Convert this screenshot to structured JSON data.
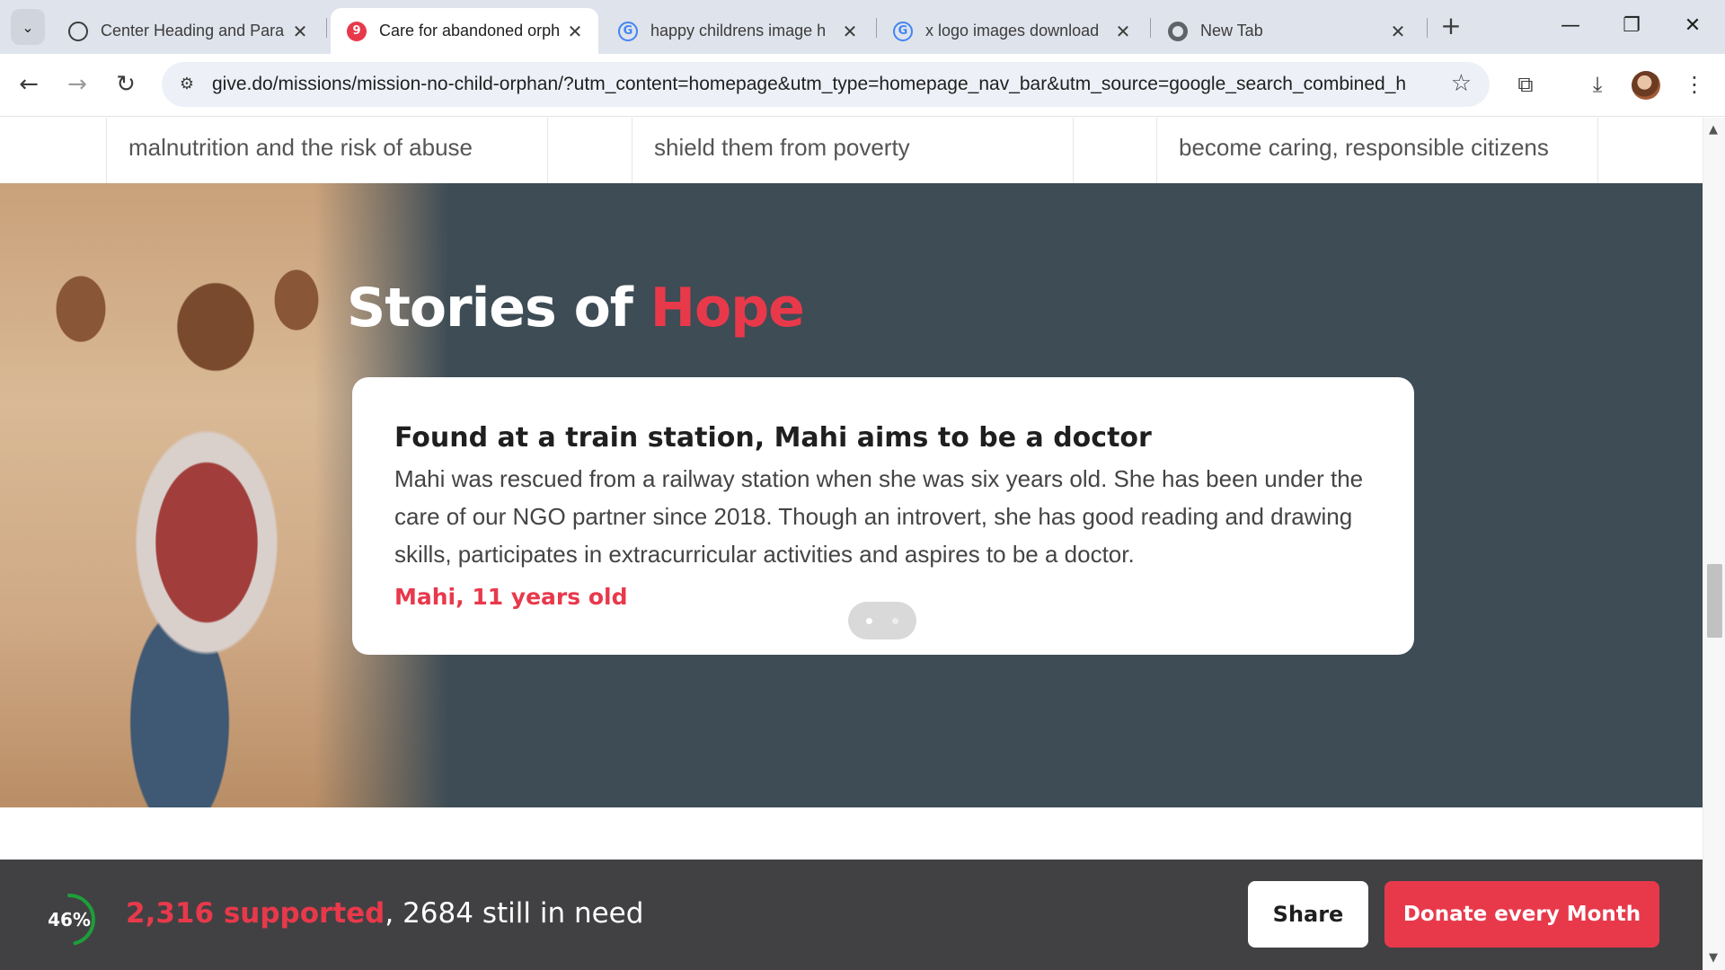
{
  "browser": {
    "tabs": [
      {
        "title": "Center Heading and Para",
        "icon": "openai-icon",
        "active": false
      },
      {
        "title": "Care for abandoned orph",
        "icon": "give-icon",
        "active": true
      },
      {
        "title": "happy childrens image h",
        "icon": "google-icon",
        "active": false
      },
      {
        "title": "x logo images download",
        "icon": "google-icon",
        "active": false
      },
      {
        "title": "New Tab",
        "icon": "chrome-icon",
        "active": false
      }
    ],
    "url": "give.do/missions/mission-no-child-orphan/?utm_content=homepage&utm_type=homepage_nav_bar&utm_source=google_search_combined_h..."
  },
  "features": [
    {
      "text": "malnutrition and the risk of abuse"
    },
    {
      "text": "shield them from poverty"
    },
    {
      "text": "become caring, responsible citizens"
    }
  ],
  "stories": {
    "title_prefix": "Stories of",
    "title_highlight": "Hope",
    "card": {
      "title": "Found at a train station, Mahi aims to be a doctor",
      "body": "Mahi was rescued from a railway station when she was six years old. She has been under the care of our NGO partner since 2018. Though an introvert, she has good reading and drawing skills, participates in extracurricular activities and aspires to be a doctor.",
      "author": "Mahi, 11 years old"
    },
    "carousel_pages": 2,
    "carousel_active": 1
  },
  "campaign": {
    "progress_fraction": 0.46,
    "progress_label": "46%",
    "supported": "2,316 supported",
    "separator": ",",
    "still_need": " 2684 still in need",
    "share_label": "Share",
    "donate_label": "Donate every Month"
  },
  "colors": {
    "accent": "#e8394b",
    "section_bg": "#3d4c55",
    "bar_bg": "#414143",
    "progress": "#1e9e3a"
  }
}
